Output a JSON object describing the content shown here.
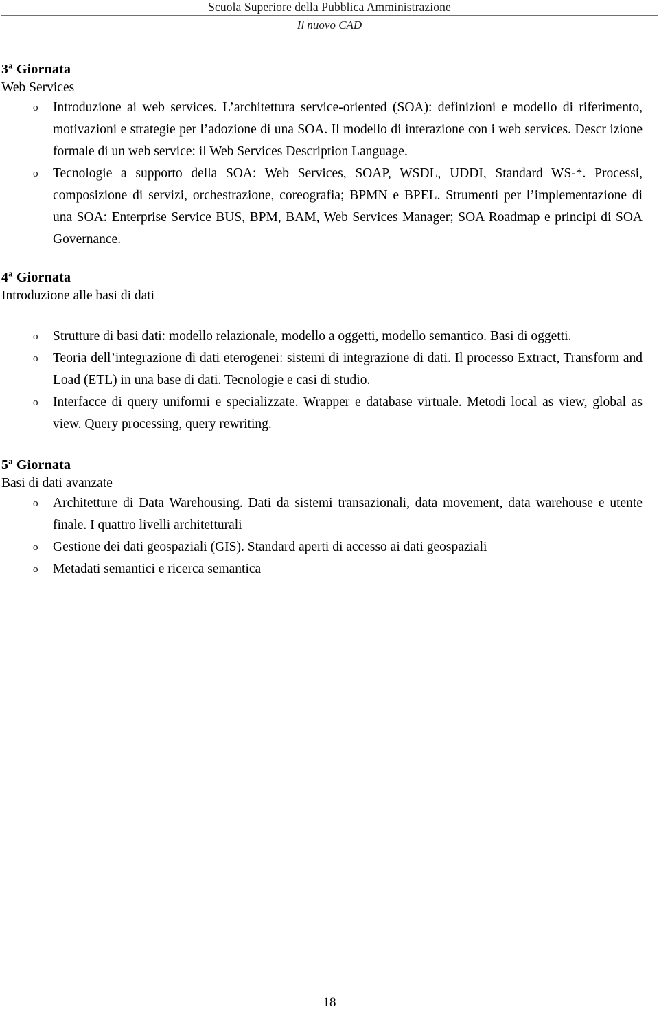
{
  "header": {
    "institution": "Scuola Superiore della Pubblica Amministrazione",
    "document_title": "Il nuovo CAD"
  },
  "footer": {
    "page_number": "18"
  },
  "sections": [
    {
      "heading_number": "3",
      "heading_ordinal": "a",
      "heading_word": "Giornata",
      "subtitle": "Web Services",
      "bullets": [
        "Introduzione ai web services. L’architettura service-oriented (SOA): definizioni e modello di riferimento, motivazioni e strategie per l’adozione di una SOA. Il modello di interazione con i web services. Descr    izione formale di un web service: il Web Services Description Language.",
        "Tecnologie a supporto della SOA: Web Services, SOAP, WSDL, UDDI, Standard WS-*. Processi, composizione di servizi, orchestrazione, coreografia; BPMN e BPEL. Strumenti per l’implementazione di una SOA: Enterprise Service BUS, BPM, BAM, Web Services Manager; SOA Roadmap e principi di SOA Governance."
      ]
    },
    {
      "heading_number": "4",
      "heading_ordinal": "a",
      "heading_word": "Giornata",
      "subtitle": "Introduzione alle basi di dati",
      "bullets": [
        "Strutture di basi dati: modello relazionale, modello a oggetti, modello semantico. Basi di oggetti.",
        "Teoria dell’integrazione di dati eterogenei: sistemi di integrazione di dati. Il processo Extract, Transform and Load (ETL) in una base di dati. Tecnologie e casi di studio.",
        "Interfacce di query uniformi e specializzate. Wrapper e database virtuale. Metodi local as view, global as view. Query processing, query rewriting."
      ]
    },
    {
      "heading_number": "5",
      "heading_ordinal": "a",
      "heading_word": "Giornata",
      "subtitle": "Basi di dati avanzate",
      "bullets": [
        "Architetture di Data Warehousing. Dati da sistemi transazionali, data movement, data warehouse e utente finale. I quattro livelli architetturali",
        "Gestione dei dati geospaziali (GIS). Standard aperti di accesso ai dati geospaziali",
        "Metadati semantici e ricerca semantica"
      ]
    }
  ],
  "bullet_marker": "o"
}
